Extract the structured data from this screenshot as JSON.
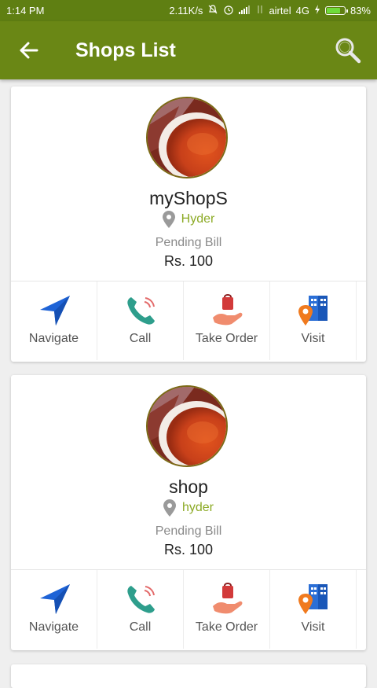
{
  "status_bar": {
    "time": "1:14 PM",
    "speed": "2.11K/s",
    "carrier": "airtel",
    "network": "4G",
    "battery": "83%",
    "battery_level": 0.83
  },
  "app_bar": {
    "title": "Shops List",
    "color": "#6a8715"
  },
  "shops": [
    {
      "name": "myShopS",
      "location": "Hyder",
      "pending_label": "Pending Bill",
      "pending_amount": "Rs. 100"
    },
    {
      "name": "shop",
      "location": "hyder",
      "pending_label": "Pending Bill",
      "pending_amount": "Rs. 100"
    }
  ],
  "actions": {
    "navigate": "Navigate",
    "call": "Call",
    "take_order": "Take Order",
    "visit": "Visit"
  },
  "colors": {
    "accent": "#8caa25",
    "navigate": "#1e63d6",
    "call": "#2e9e8c"
  }
}
